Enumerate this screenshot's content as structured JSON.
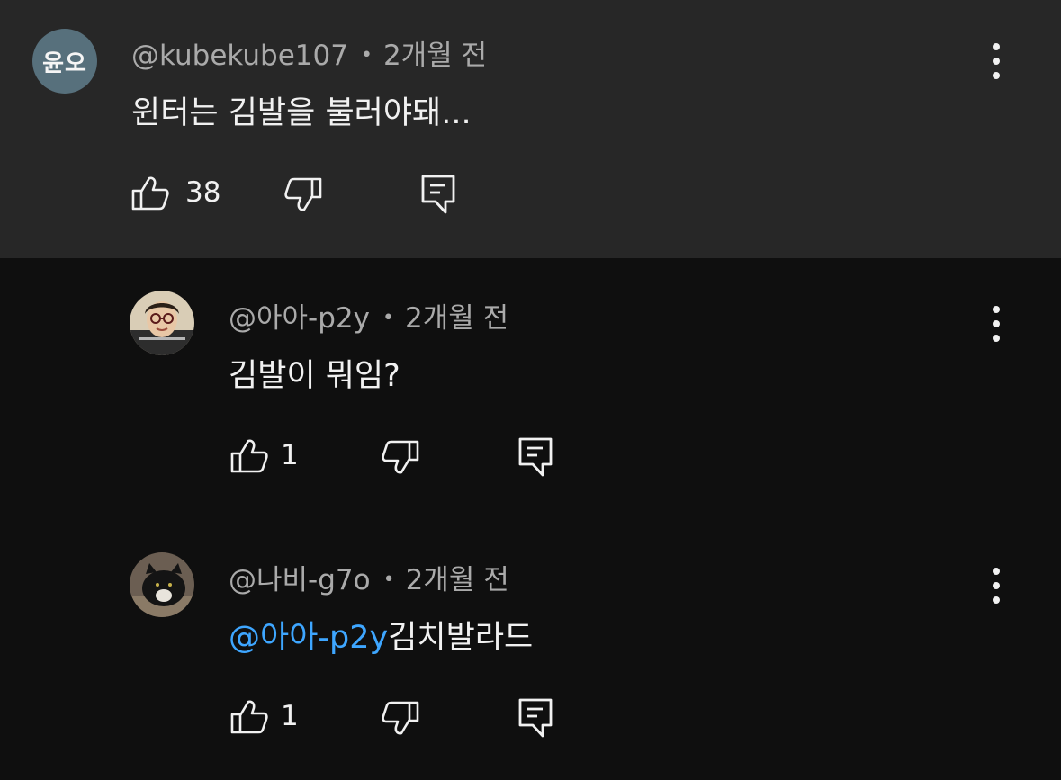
{
  "comment": {
    "avatar_text": "윤오",
    "author": "@kubekube107",
    "separator": "•",
    "time": "2개월 전",
    "text": "윈터는 김발을 불러야돼...",
    "likes": "38"
  },
  "replies": [
    {
      "author": "@아아-p2y",
      "separator": "•",
      "time": "2개월 전",
      "text": "김발이 뭐임?",
      "likes": "1"
    },
    {
      "author": "@나비-g7o",
      "separator": "•",
      "time": "2개월 전",
      "mention": "@아아-p2y",
      "text": "김치발라드",
      "likes": "1"
    }
  ],
  "icons": {
    "like": "thumbs-up-icon",
    "dislike": "thumbs-down-icon",
    "reply": "reply-icon",
    "more": "more-vertical-icon"
  },
  "colors": {
    "main_bg": "#272727",
    "reply_bg": "#0f0f0f",
    "meta_text": "#aaaaaa",
    "mention": "#3ea6ff",
    "avatar_bg": "#57707c"
  }
}
